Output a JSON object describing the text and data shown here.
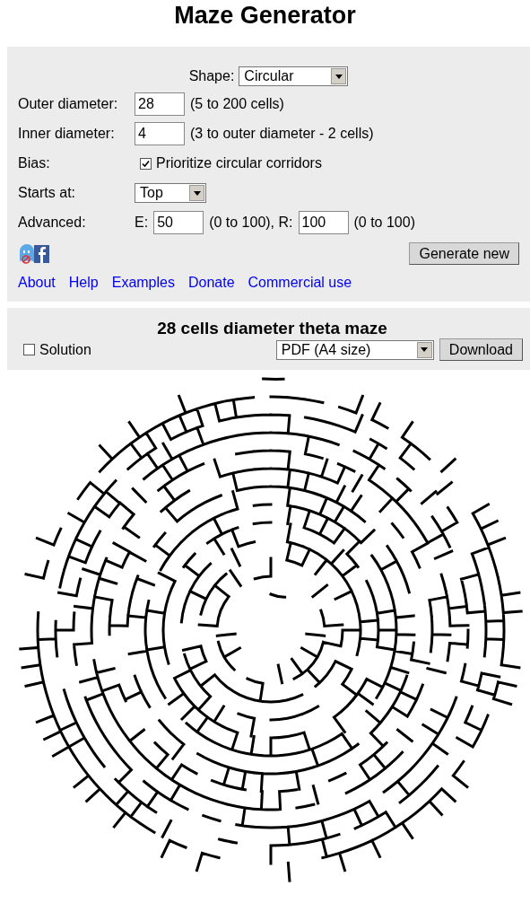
{
  "title": "Maze Generator",
  "form": {
    "shape": {
      "label": "Shape:",
      "value": "Circular"
    },
    "outer": {
      "label": "Outer diameter:",
      "value": "28",
      "hint": "(5 to 200 cells)"
    },
    "inner": {
      "label": "Inner diameter:",
      "value": "4",
      "hint": "(3 to outer diameter - 2 cells)"
    },
    "bias": {
      "label": "Bias:",
      "option": "Prioritize circular corridors",
      "checked": true
    },
    "starts": {
      "label": "Starts at:",
      "value": "Top"
    },
    "advanced": {
      "label": "Advanced:",
      "e_label": "E:",
      "e_value": "50",
      "e_hint": "(0 to 100), R:",
      "r_value": "100",
      "r_hint": "(0 to 100)"
    },
    "generate_button": "Generate new"
  },
  "links": [
    "About",
    "Help",
    "Examples",
    "Donate",
    "Commercial use"
  ],
  "result": {
    "title": "28 cells diameter theta maze",
    "solution": {
      "label": "Solution",
      "checked": false
    },
    "format": "PDF (A4 size)",
    "download_button": "Download"
  }
}
